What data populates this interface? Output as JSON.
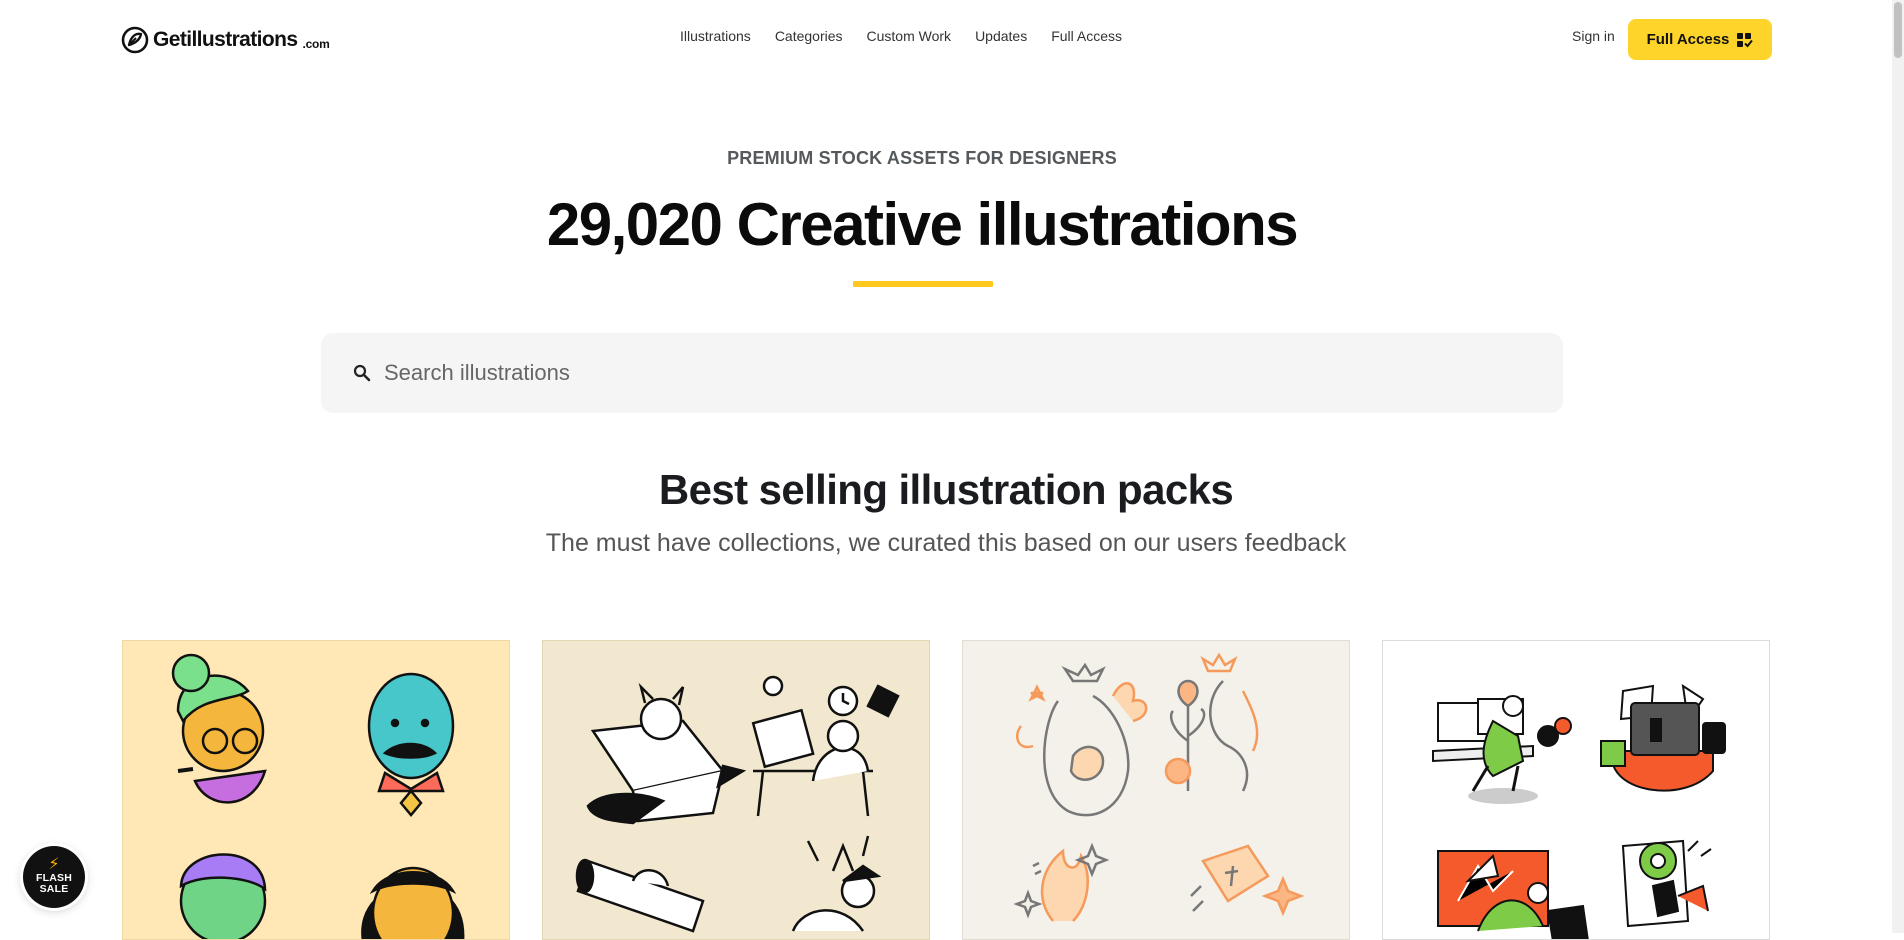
{
  "header": {
    "logo_text": "Getillustrations",
    "logo_tld": ".com",
    "nav": [
      {
        "label": "Illustrations"
      },
      {
        "label": "Categories"
      },
      {
        "label": "Custom Work"
      },
      {
        "label": "Updates"
      },
      {
        "label": "Full Access"
      }
    ],
    "signin_label": "Sign in",
    "cta_label": "Full Access"
  },
  "hero": {
    "eyebrow": "PREMIUM STOCK ASSETS FOR DESIGNERS",
    "title": "29,020 Creative illustrations",
    "accent_color": "#ffc81f"
  },
  "search": {
    "placeholder": "Search illustrations",
    "value": ""
  },
  "section": {
    "title": "Best selling illustration packs",
    "subtitle": "The must have collections, we curated this based on our users feedback"
  },
  "flash": {
    "line1": "FLASH",
    "line2": "SALE"
  },
  "colors": {
    "cta": "#ffd42a",
    "card1_bg": "#ffe7b6",
    "card2_bg": "#f2e8cf",
    "card3_bg": "#f4f1ea",
    "card4_bg": "#ffffff"
  }
}
